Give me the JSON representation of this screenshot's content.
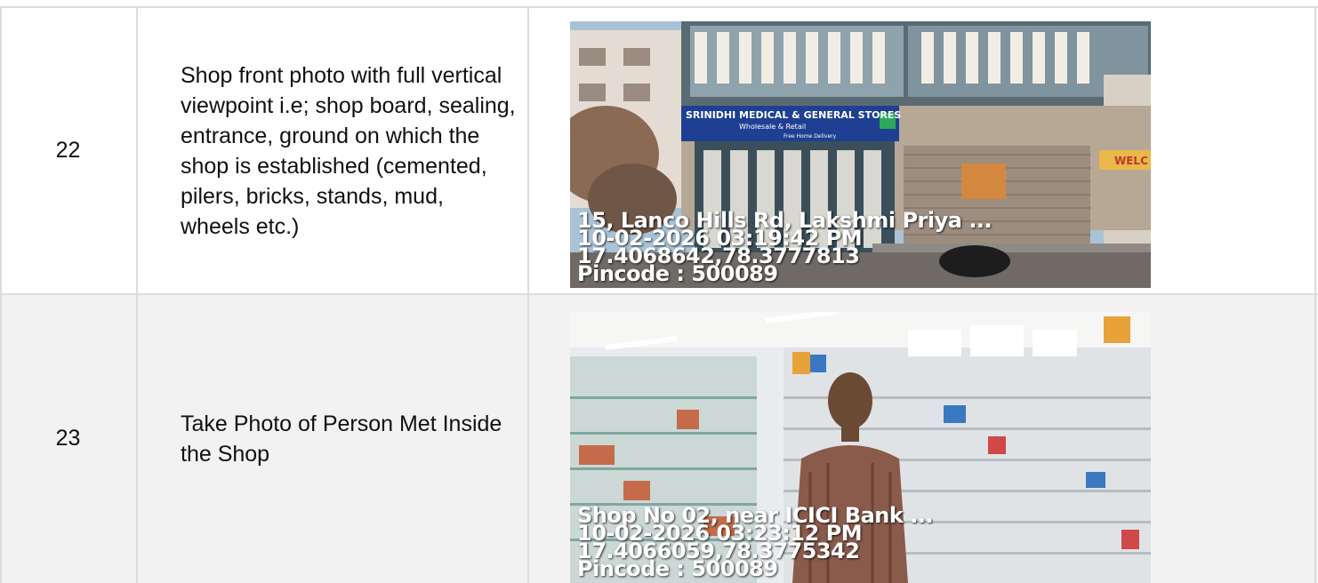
{
  "rows": [
    {
      "number": "22",
      "description": "Shop front photo with full vertical viewpoint i.e; shop board, sealing, entrance, ground on which the shop is established (cemented, pilers, bricks, stands, mud, wheels etc.)",
      "photo": {
        "sign_title": "SRINIDHI MEDICAL & GENERAL STORES",
        "sign_subtitle": "Wholesale & Retail",
        "sign_extra": "Free Home Delivery",
        "right_sign": "WELC",
        "overlay": {
          "address": "15, Lanco Hills Rd, Lakshmi Priya ...",
          "datetime": "10-02-2026 03:19:42 PM",
          "coords": "17.4068642,78.3777813",
          "pincode": "Pincode : 500089"
        }
      }
    },
    {
      "number": "23",
      "description": "Take Photo of Person Met Inside the Shop",
      "photo": {
        "overlay": {
          "address": "Shop No 02, near ICICI Bank ...",
          "datetime": "10-02-2026 03:23:12 PM",
          "coords": "17.4066059,78.3775342",
          "pincode": "Pincode : 500089"
        }
      }
    }
  ],
  "colors": {
    "sign_blue": "#1f3f93",
    "row_alt_bg": "#f2f2f2",
    "border": "#dcdcdc"
  }
}
